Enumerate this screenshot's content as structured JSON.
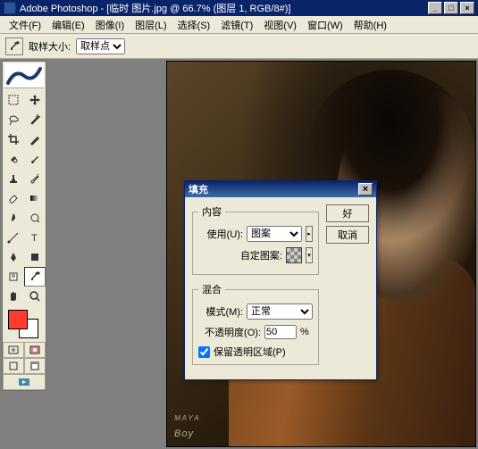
{
  "app": {
    "title": "Adobe Photoshop - [临时 图片.jpg @ 66.7% (图层 1, RGB/8#)]"
  },
  "menu": {
    "items": [
      "文件(F)",
      "编辑(E)",
      "图像(I)",
      "图层(L)",
      "选择(S)",
      "滤镜(T)",
      "视图(V)",
      "窗口(W)",
      "帮助(H)"
    ]
  },
  "options": {
    "label": "取样大小:",
    "value": "取样点"
  },
  "canvas": {
    "watermark_small": "MAYA",
    "watermark_main": "Boy"
  },
  "colors": {
    "foreground": "#ff3b2e",
    "background": "#ffffff"
  },
  "dialog": {
    "title": "填充",
    "ok": "好",
    "cancel": "取消",
    "group_content": "内容",
    "use_label": "使用(U):",
    "use_value": "图案",
    "custom_pattern_label": "自定图案:",
    "group_blend": "混合",
    "mode_label": "模式(M):",
    "mode_value": "正常",
    "opacity_label": "不透明度(O):",
    "opacity_value": "50",
    "opacity_unit": "%",
    "preserve_transparency": "保留透明区域(P)",
    "preserve_checked": true
  }
}
